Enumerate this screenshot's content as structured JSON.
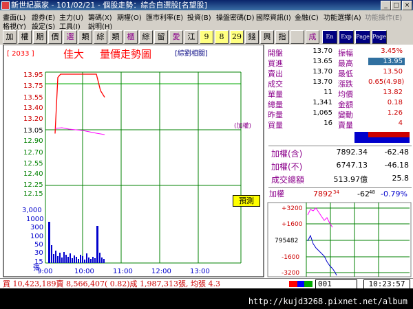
{
  "titlebar": {
    "title": "新世紀贏家 - 101/02/21 - 個股走勢：綜合自選股[名望股]"
  },
  "menubar": {
    "row1": [
      "畫面(L)",
      "證券(E)",
      "主力(U)",
      "籌碼(X)",
      "期權(O)",
      "匯市利率(E)",
      "投資(B)",
      "操盤密碼(D)",
      "國際資訊(I)",
      "金融(C)",
      "功能選擇(A)",
      "功能操作(E)"
    ],
    "row2": [
      "格視(Y)",
      "設定(S)",
      "工具(I)",
      "說明(H)"
    ]
  },
  "toolbar": {
    "buttons": [
      "加",
      "權",
      "期",
      "價",
      "選",
      "類",
      "綜",
      "類",
      "櫃",
      "綜",
      "留",
      "愛",
      "江",
      "9",
      "8",
      "29",
      "錢",
      "興",
      "指",
      "",
      "成",
      "En",
      "Exp",
      "Page",
      "Page"
    ]
  },
  "chart": {
    "stock_code": "[ 2033 ]",
    "stock_name": "佳大",
    "title": "量價走勢圖",
    "related": "[綜劉相關]",
    "price_ticks": [
      "13.95",
      "13.75",
      "13.55",
      "13.40",
      "13.20",
      "13.05",
      "12.90",
      "12.70",
      "12.55",
      "12.40",
      "12.25",
      "12.15"
    ],
    "volume_ticks": [
      "3,000",
      "1000",
      "300",
      "100",
      "50",
      "30",
      "15",
      "張"
    ],
    "time_ticks": [
      "9:00",
      "10:00",
      "11:00",
      "12:00",
      "13:00"
    ],
    "side_note": "(加權)",
    "badge": "預測"
  },
  "quote": {
    "rows": [
      {
        "l1": "開盤",
        "v1": "13.70",
        "l2": "振幅",
        "v2": "3.45%"
      },
      {
        "l1": "買進",
        "v1": "13.65",
        "l2": "最高",
        "v2": "13.95"
      },
      {
        "l1": "賣出",
        "v1": "13.70",
        "l2": "最低",
        "v2": "13.50"
      },
      {
        "l1": "成交",
        "v1": "13.70",
        "l2": "漲跌",
        "v2": "0.65(4.98)"
      },
      {
        "l1": "單量",
        "v1": "11",
        "l2": "均價",
        "v2": "13.82"
      },
      {
        "l1": "總量",
        "v1": "1,341",
        "l2": "金額",
        "v2": "0.18"
      },
      {
        "l1": "昨量",
        "v1": "1,065",
        "l2": "變動",
        "v2": "1.26"
      },
      {
        "l1": "買量",
        "v1": "16",
        "l2": "賣量",
        "v2": "4"
      }
    ],
    "index_rows": [
      {
        "label": "加權(含)",
        "value": "7892.34",
        "change": "-62.48"
      },
      {
        "label": "加權(不)",
        "value": "6747.13",
        "change": "-46.18"
      },
      {
        "label": "成交總額",
        "value": "513.97億",
        "change": "25.8"
      }
    ],
    "mini": {
      "label": "加權",
      "value": "7892",
      "value_sup": "34",
      "change": "-62",
      "change_sup": "48",
      "pct": "-0.79%",
      "ticks": [
        "+3200",
        "+1600",
        "795482",
        "-1600",
        "-3200"
      ]
    }
  },
  "statusbar": {
    "text": "買 10,423,189賣 8,566,407( 0.82)成 1,987,313張, 均張 4.3",
    "code": "001",
    "time": "10:23:57"
  },
  "footer": {
    "url": "http://kujd3268.pixnet.net/album"
  },
  "colors": {
    "price_line": "#ff0000",
    "avg_line": "#ff00ff",
    "volume_bar": "#0000cc",
    "grid": "#008000",
    "label": "#8b008b"
  },
  "chart_data": {
    "type": "line",
    "x": [
      "9:00",
      "9:10",
      "9:20",
      "9:30",
      "9:40",
      "9:50",
      "10:00",
      "10:10",
      "10:15"
    ],
    "series": [
      {
        "values": [
          13.05,
          13.9,
          13.95,
          13.95,
          13.95,
          13.95,
          13.95,
          13.7,
          13.6
        ]
      }
    ],
    "xlabel": "",
    "ylabel": "",
    "ylim": [
      12.15,
      13.95
    ]
  }
}
